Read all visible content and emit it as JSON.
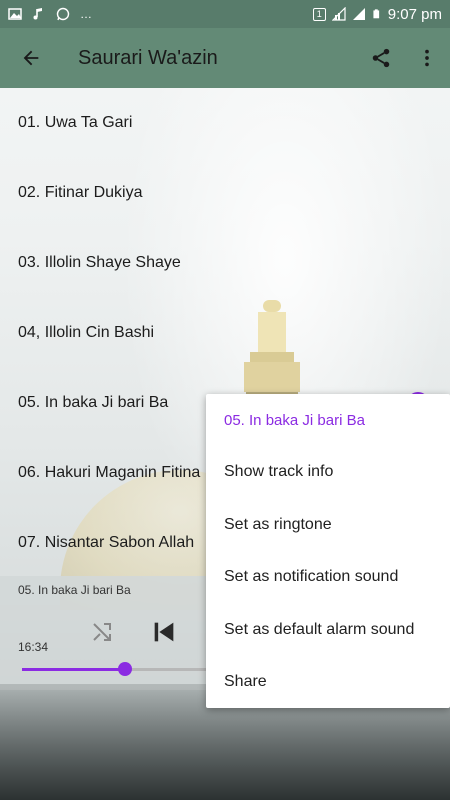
{
  "status_bar": {
    "time": "9:07 pm",
    "sim_badge": "1",
    "left_icons": [
      "image-icon",
      "music-note-icon",
      "whatsapp-icon",
      "more-dots-icon"
    ],
    "right_icons": [
      "battery-icon",
      "signal-icon",
      "wifi-icon"
    ]
  },
  "app_bar": {
    "title": "Saurari Wa'azin",
    "background": "#638a76"
  },
  "tracks": [
    {
      "label": "01. Uwa Ta Gari"
    },
    {
      "label": "02. Fitinar Dukiya"
    },
    {
      "label": "03. Illolin Shaye Shaye"
    },
    {
      "label": "04, Illolin Cin Bashi"
    },
    {
      "label": "05. In baka Ji bari Ba"
    },
    {
      "label": "06. Hakuri Maganin Fitina"
    },
    {
      "label": "07. Nisantar Sabon Allah"
    }
  ],
  "player": {
    "now_playing": "05. In baka Ji bari Ba",
    "elapsed": "16:34",
    "progress": 0.24,
    "accent": "#8b2be2"
  },
  "context_menu": {
    "header": "05. In baka Ji bari Ba",
    "items": [
      {
        "label": "Show track info"
      },
      {
        "label": "Set as ringtone"
      },
      {
        "label": "Set as notification sound"
      },
      {
        "label": "Set as default alarm sound"
      },
      {
        "label": "Share"
      }
    ]
  }
}
